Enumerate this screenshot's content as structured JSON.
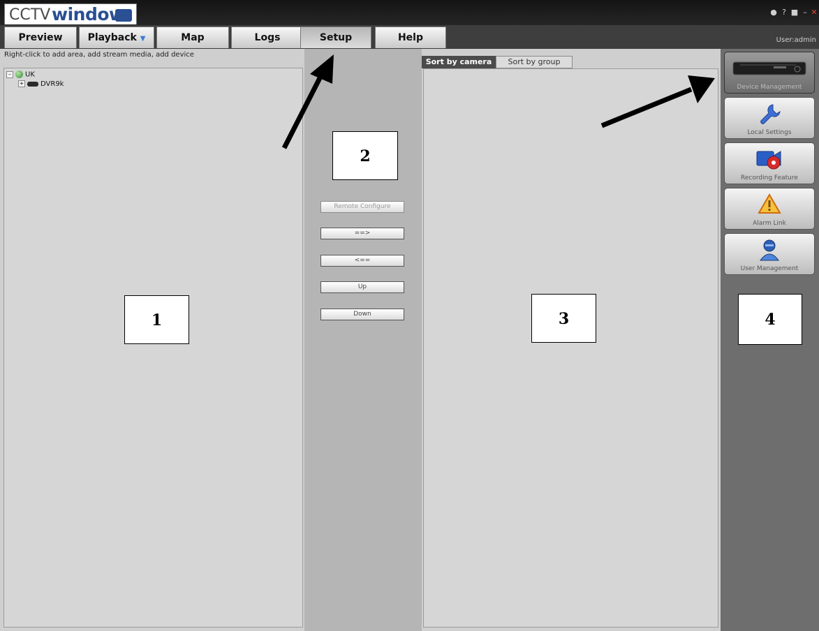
{
  "app": {
    "logo_prefix": "CCTV",
    "logo_word": "window",
    "window_controls": [
      "user-icon",
      "help-icon",
      "lock-icon",
      "minimize-icon",
      "close-icon"
    ]
  },
  "tabs": [
    {
      "label": "Preview"
    },
    {
      "label": "Playback",
      "has_dropdown": true
    },
    {
      "label": "Map"
    },
    {
      "label": "Logs"
    },
    {
      "label": "Setup",
      "active": true
    },
    {
      "label": "Help"
    }
  ],
  "user_label": "User:admin",
  "left_panel": {
    "hint": "Right-click to add area, add stream media, add device",
    "tree": [
      {
        "label": "UK",
        "expanded": true,
        "icon": "globe-icon"
      },
      {
        "label": "DVR9k",
        "expanded": false,
        "icon": "dvr-icon"
      }
    ]
  },
  "middle_buttons": [
    {
      "label": "Remote Configure",
      "disabled": true
    },
    {
      "label": "==>"
    },
    {
      "label": "<=="
    },
    {
      "label": "Up"
    },
    {
      "label": "Down"
    }
  ],
  "right_panel": {
    "tabs": [
      {
        "label": "Sort by camera",
        "active": true
      },
      {
        "label": "Sort by group"
      }
    ]
  },
  "sidebar": [
    {
      "label": "Device Management",
      "icon": "dvr-device-icon",
      "active": true
    },
    {
      "label": "Local Settings",
      "icon": "wrench-icon"
    },
    {
      "label": "Recording Feature",
      "icon": "record-icon"
    },
    {
      "label": "Alarm Link",
      "icon": "warning-icon"
    },
    {
      "label": "User Management",
      "icon": "user-icon"
    }
  ],
  "annotations": [
    "1",
    "2",
    "3",
    "4"
  ],
  "colors": {
    "accent": "#2a4f93",
    "titlebar": "#1a1a1a",
    "panel": "#cfcfcf"
  }
}
